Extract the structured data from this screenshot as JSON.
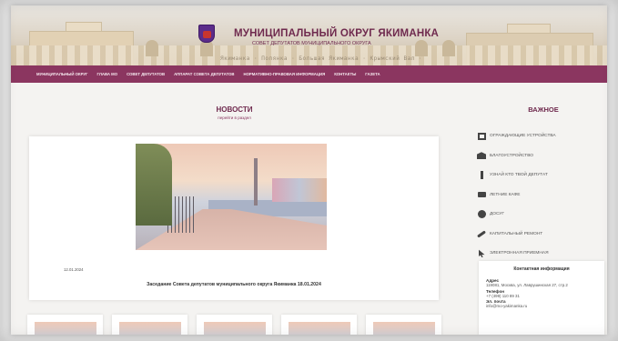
{
  "header": {
    "title": "МУНИЦИПАЛЬНЫЙ ОКРУГ ЯКИМАНКА",
    "subtitle": "СОВЕТ ДЕПУТАТОВ МУНИЦИПАЛЬНОГО ОКРУГА",
    "fence_text": "Якиманка · Полянка · Большая Якиманка · Крымский Вал · Остоженка"
  },
  "nav": {
    "items": [
      "МУНИЦИПАЛЬНЫЙ ОКРУГ",
      "ГЛАВА МО",
      "СОВЕТ ДЕПУТАТОВ",
      "АППАРАТ СОВЕТА ДЕПУТАТОВ",
      "НОРМАТИВНО-ПРАВОВАЯ ИНФОРМАЦИЯ",
      "КОНТАКТЫ",
      "ГАЗЕТА"
    ]
  },
  "news": {
    "title": "НОВОСТИ",
    "link": "перейти в раздел",
    "date": "12.01.2024",
    "caption": "Заседание Совета депутатов муниципального округа Якиманка 18.01.2024"
  },
  "sidebar": {
    "title": "ВАЖНОЕ",
    "items": [
      {
        "label": "ОГРАЖДАЮЩИЕ УСТРОЙСТВА",
        "icon": "frame-icon"
      },
      {
        "label": "БЛАГОУСТРОЙСТВО",
        "icon": "building-icon"
      },
      {
        "label": "УЗНАЙ КТО ТВОЙ ДЕПУТАТ",
        "icon": "info-icon"
      },
      {
        "label": "ЛЕТНИЕ КАФЕ",
        "icon": "cafe-icon"
      },
      {
        "label": "ДОСУГ",
        "icon": "leisure-icon"
      },
      {
        "label": "КАПИТАЛЬНЫЙ РЕМОНТ",
        "icon": "wrench-icon"
      },
      {
        "label": "ЭЛЕКТРОННАЯ ПРИЕМНАЯ",
        "icon": "cursor-icon"
      }
    ],
    "contact": {
      "title": "Контактная информация",
      "address_label": "Адрес",
      "address": "119081, Москва, ул. Лаврушинская 27, стр.2",
      "phone_label": "Телефон",
      "phone": "+7 (499) 110 89 31",
      "email_label": "Эл. почта",
      "email": "info@mo-yakimanka.ru"
    }
  },
  "colors": {
    "brand": "#8b3660",
    "title": "#6f2a4e",
    "background": "#f4f3f1"
  }
}
